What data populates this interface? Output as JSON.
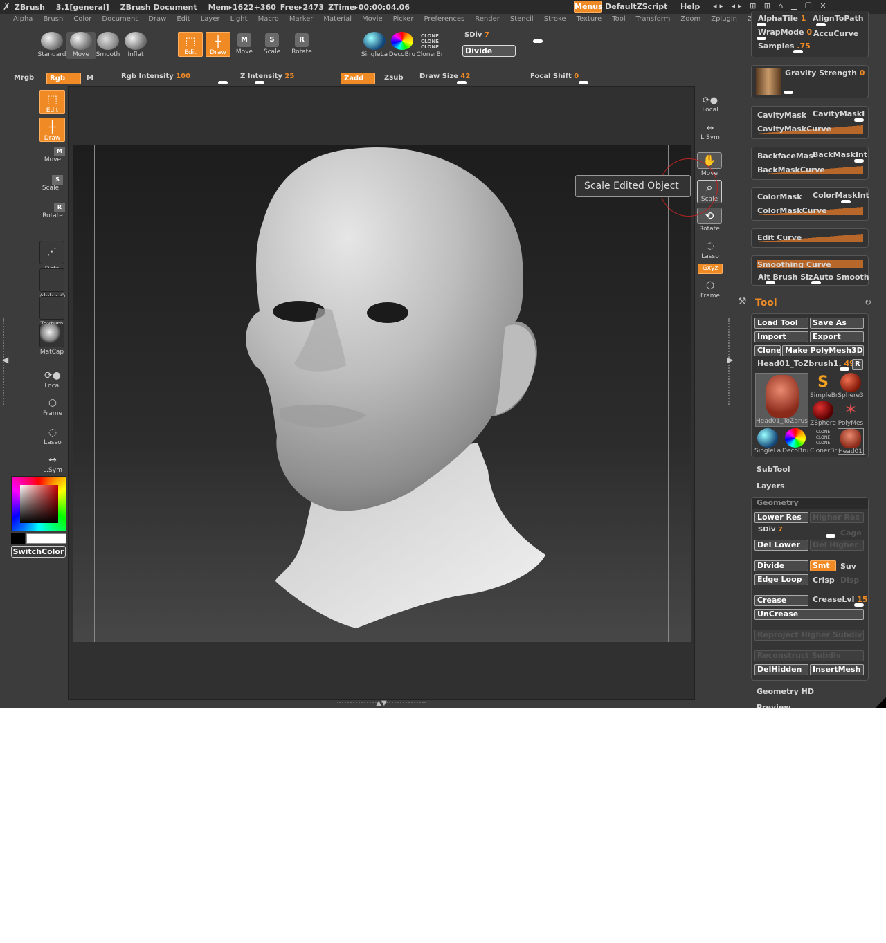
{
  "title_bar": {
    "app": "ZBrush",
    "version": "3.1[general]",
    "document": "ZBrush Document",
    "mem": "Mem▸1622+360",
    "free": "Free▸2473",
    "ztime": "ZTime▸00:00:04.06",
    "menus_label": "Menus",
    "script": "DefaultZScript",
    "help": "Help"
  },
  "menu": [
    "Alpha",
    "Brush",
    "Color",
    "Document",
    "Draw",
    "Edit",
    "Layer",
    "Light",
    "Macro",
    "Marker",
    "Material",
    "Movie",
    "Picker",
    "Preferences",
    "Render",
    "Stencil",
    "Stroke",
    "Texture",
    "Tool",
    "Transform",
    "Zoom",
    "Zplugin",
    "Zscript"
  ],
  "toolbar": {
    "brushes": [
      "Standard",
      "Move",
      "Smooth",
      "Inflat"
    ],
    "edit": "Edit",
    "draw": "Draw",
    "move": "Move",
    "scale": "Scale",
    "rotate": "Rotate",
    "tools": [
      "SingleLa",
      "DecoBru",
      "ClonerBr"
    ],
    "sdiv_label": "SDiv",
    "sdiv_value": "7",
    "divide": "Divide",
    "mrgb": "Mrgb",
    "rgb": "Rgb",
    "m": "M",
    "rgb_intensity_label": "Rgb Intensity",
    "rgb_intensity_value": "100",
    "z_intensity_label": "Z Intensity",
    "z_intensity_value": "25",
    "zadd": "Zadd",
    "zsub": "Zsub",
    "draw_size_label": "Draw Size",
    "draw_size_value": "42",
    "focal_shift_label": "Focal Shift",
    "focal_shift_value": "0"
  },
  "left_shelf": {
    "edit": "Edit",
    "draw": "Draw",
    "move": "Move",
    "scale": "Scale",
    "rotate": "Rotate",
    "dots": "Dots",
    "alpha": "Alpha_O",
    "texture": "Texture",
    "matcap": "MatCap",
    "local": "Local",
    "frame": "Frame",
    "lasso": "Lasso",
    "lsym": "L.Sym",
    "switch_color": "SwitchColor"
  },
  "right_shelf": {
    "local": "Local",
    "lsym": "L.Sym",
    "move": "Move",
    "scale": "Scale",
    "rotate": "Rotate",
    "lasso": "Lasso",
    "xyz": "Gxyz",
    "frame": "Frame"
  },
  "tooltip": "Scale Edited Object",
  "brush_panel": {
    "alpha_tile": "AlphaTile",
    "alpha_tile_value": "1",
    "align_to_path": "AlignToPath",
    "wrap_mode": "WrapMode",
    "wrap_mode_value": "0",
    "accu_curve": "AccuCurve",
    "samples": "Samples",
    "samples_value": ".75",
    "gravity_strength": "Gravity Strength",
    "gravity_value": "0",
    "cavity_mask": "CavityMask",
    "cavity_mask_int": "CavityMaskIn",
    "cavity_mask_curve": "CavityMaskCurve",
    "backface_mask": "BackfaceMas",
    "back_mask_int": "BackMaskInt",
    "back_mask_curve": "BackMaskCurve",
    "color_mask": "ColorMask",
    "color_mask_int": "ColorMaskInt",
    "color_mask_curve": "ColorMaskCurve",
    "edit_curve": "Edit Curve",
    "smoothing_curve": "Smoothing Curve",
    "alt_brush_size": "Alt Brush Siz",
    "auto_smooth": "Auto Smooth"
  },
  "tool_panel": {
    "title": "Tool",
    "load_tool": "Load Tool",
    "save_as": "Save As",
    "import": "Import",
    "export": "Export",
    "clone": "Clone",
    "make_polymesh": "Make PolyMesh3D",
    "current_tool": "Head01_ToZbrush1.",
    "current_tool_value": "49",
    "r": "R",
    "thumbs": [
      "Head01_ToZbrus",
      "SimpleBr",
      "Sphere3",
      "ZSphere",
      "PolyMes",
      "SingleLa",
      "DecoBru",
      "ClonerBr",
      "Head01_"
    ],
    "subtool": "SubTool",
    "layers": "Layers",
    "geometry": "Geometry",
    "lower_res": "Lower Res",
    "higher_res": "Higher Res",
    "sdiv": "SDiv",
    "sdiv_value": "7",
    "cage": "Cage",
    "del_lower": "Del Lower",
    "del_higher": "Del Higher",
    "divide": "Divide",
    "smt": "Smt",
    "suv": "Suv",
    "edge_loop": "Edge Loop",
    "crisp": "Crisp",
    "disp": "Disp",
    "crease": "Crease",
    "crease_lvl": "CreaseLvl",
    "crease_lvl_value": "15",
    "uncrease": "UnCrease",
    "reproject": "Reproject Higher Subdiv",
    "reconstruct": "Reconstruct Subdiv",
    "del_hidden": "DelHidden",
    "insert_mesh": "InsertMesh",
    "geometry_hd": "Geometry HD",
    "preview": "Preview"
  }
}
